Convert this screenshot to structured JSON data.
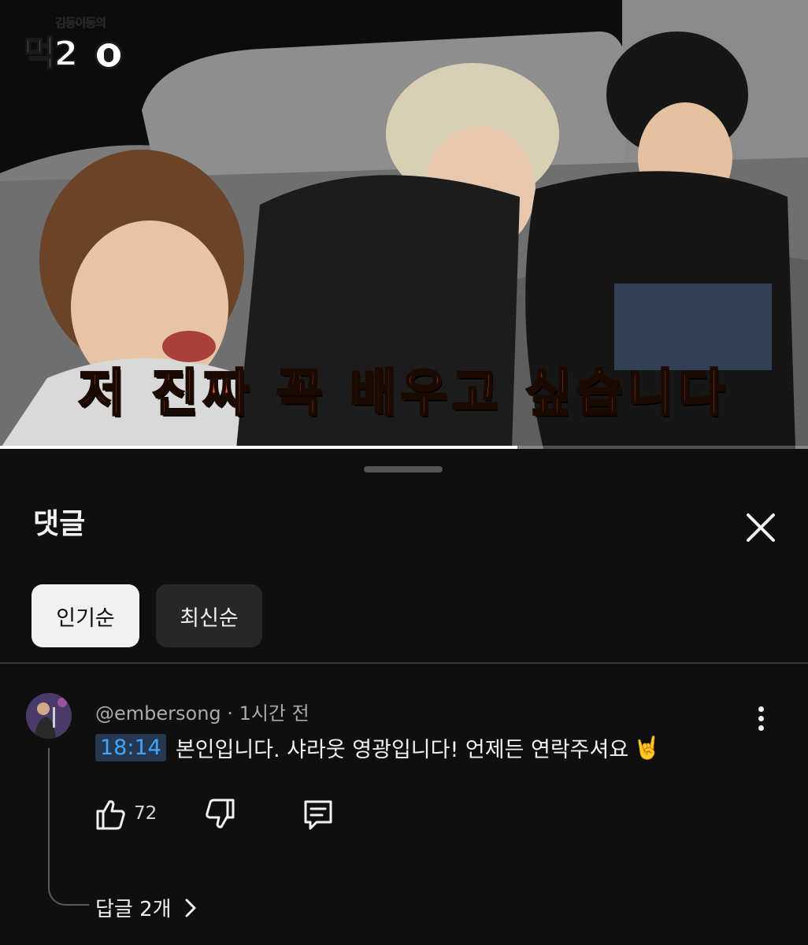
{
  "video": {
    "channel_logo_small": "김동이동의",
    "channel_logo_main": "먹2",
    "subtitle": "저 진짜 꼭 배우고 싶습니다",
    "progress": 0.64
  },
  "comments_panel": {
    "title": "댓글",
    "close_icon": "close-icon",
    "sort_chips": [
      {
        "label": "인기순",
        "active": true
      },
      {
        "label": "최신순",
        "active": false
      }
    ]
  },
  "comment": {
    "author": "@embersong",
    "separator": "·",
    "time": "1시간 전",
    "timestamp": "18:14",
    "text": "본인입니다. 샤라웃 영광입니다! 언제든 연락주셔요",
    "emoji": "🤘",
    "like_count": "72",
    "replies_label": "답글 2개",
    "icons": {
      "like": "thumbs-up-icon",
      "dislike": "thumbs-down-icon",
      "reply": "reply-icon",
      "more": "more-vert-icon",
      "expand": "chevron-right-icon"
    }
  },
  "colors": {
    "background": "#0f0f0f",
    "subtitle_orange": "#ff5a1f",
    "timestamp_link": "#3ea6ff",
    "chip_active_bg": "#f1f1f1",
    "chip_inactive_bg": "#272727"
  }
}
